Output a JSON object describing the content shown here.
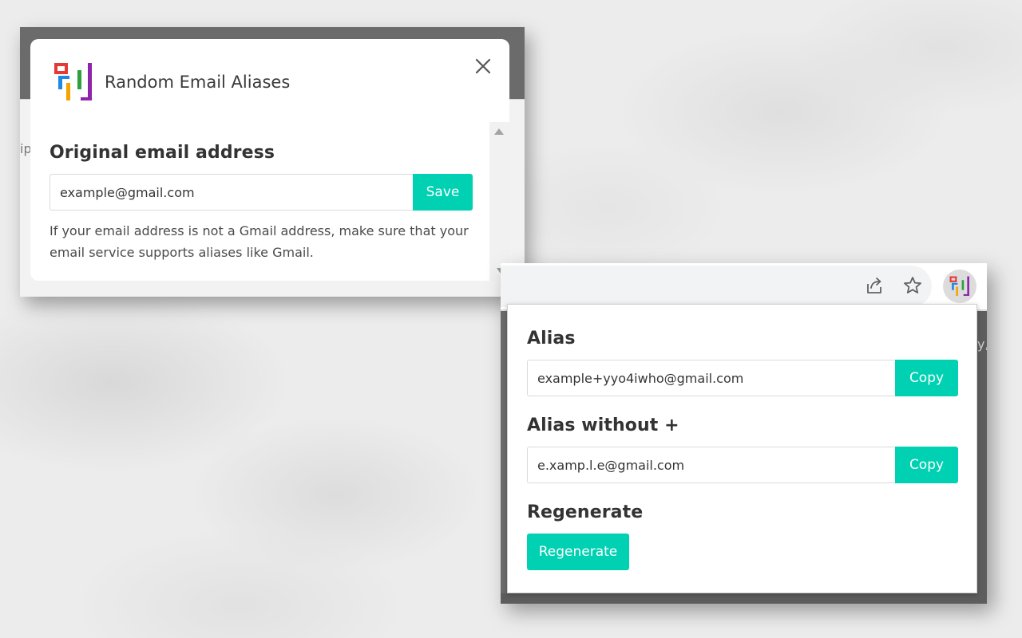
{
  "options": {
    "app_title": "Random Email Aliases",
    "section_heading": "Original email address",
    "email_value": "example@gmail.com",
    "save_label": "Save",
    "help_text": "If your email address is not a Gmail address, make sure that your email service supports aliases like Gmail.",
    "background_fragment": "ip"
  },
  "popup": {
    "right_fragment": "y,",
    "toolbar": {
      "share_icon": "share-icon",
      "bookmark_icon": "star-icon",
      "extension_icon": "random-email-aliases-logo"
    },
    "alias_heading": "Alias",
    "alias_value": "example+yyo4iwho@gmail.com",
    "copy_label": "Copy",
    "alias_noplus_heading": "Alias without +",
    "alias_noplus_value": "e.xamp.l.e@gmail.com",
    "copy2_label": "Copy",
    "regenerate_heading": "Regenerate",
    "regenerate_label": "Regenerate"
  },
  "colors": {
    "accent": "#00d1b2",
    "logo_red": "#e53935",
    "logo_blue": "#1e88e5",
    "logo_yellow": "#f4a300",
    "logo_green": "#2e9e3f",
    "logo_purple": "#8e24aa"
  }
}
